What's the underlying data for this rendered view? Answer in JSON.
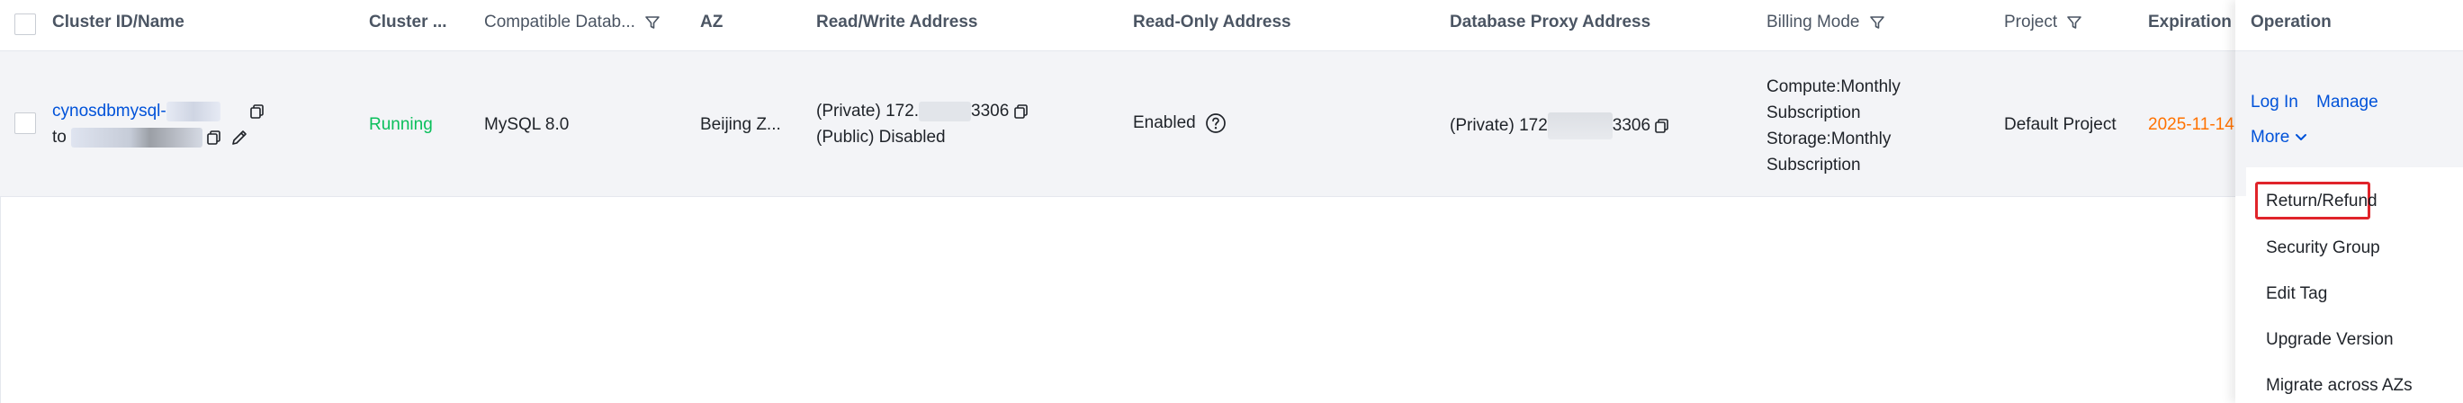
{
  "table": {
    "headers": {
      "cluster_id": "Cluster ID/Name",
      "cluster_status": "Cluster ...",
      "compatible_db": "Compatible Datab...",
      "az": "AZ",
      "rw_address": "Read/Write Address",
      "ro_address": "Read-Only Address",
      "proxy_address": "Database Proxy Address",
      "billing_mode": "Billing Mode",
      "project": "Project",
      "expiration": "Expiration",
      "operation": "Operation"
    },
    "row": {
      "cluster_id": "cynosdbmysql-",
      "cluster_name_prefix": "to",
      "status": "Running",
      "compatible_db": "MySQL 8.0",
      "az": "Beijing Z...",
      "rw_private_prefix": "(Private) 172.",
      "rw_private_suffix": "3306",
      "rw_public": "(Public) Disabled",
      "ro_status": "Enabled",
      "proxy_prefix": "(Private) 172",
      "proxy_suffix": "3306",
      "billing_line1": "Compute:Monthly",
      "billing_line2": "Subscription",
      "billing_line3": "Storage:Monthly",
      "billing_line4": "Subscription",
      "project": "Default Project",
      "expiration": "2025-11-14"
    }
  },
  "operation": {
    "login": "Log In",
    "manage": "Manage",
    "more": "More"
  },
  "more_menu": {
    "items": [
      "Return/Refund",
      "Security Group",
      "Edit Tag",
      "Upgrade Version",
      "Migrate across AZs"
    ]
  },
  "colors": {
    "link": "#0052d9",
    "running": "#0abf5b",
    "expiration": "#ff7200",
    "highlight": "#e0242a"
  }
}
